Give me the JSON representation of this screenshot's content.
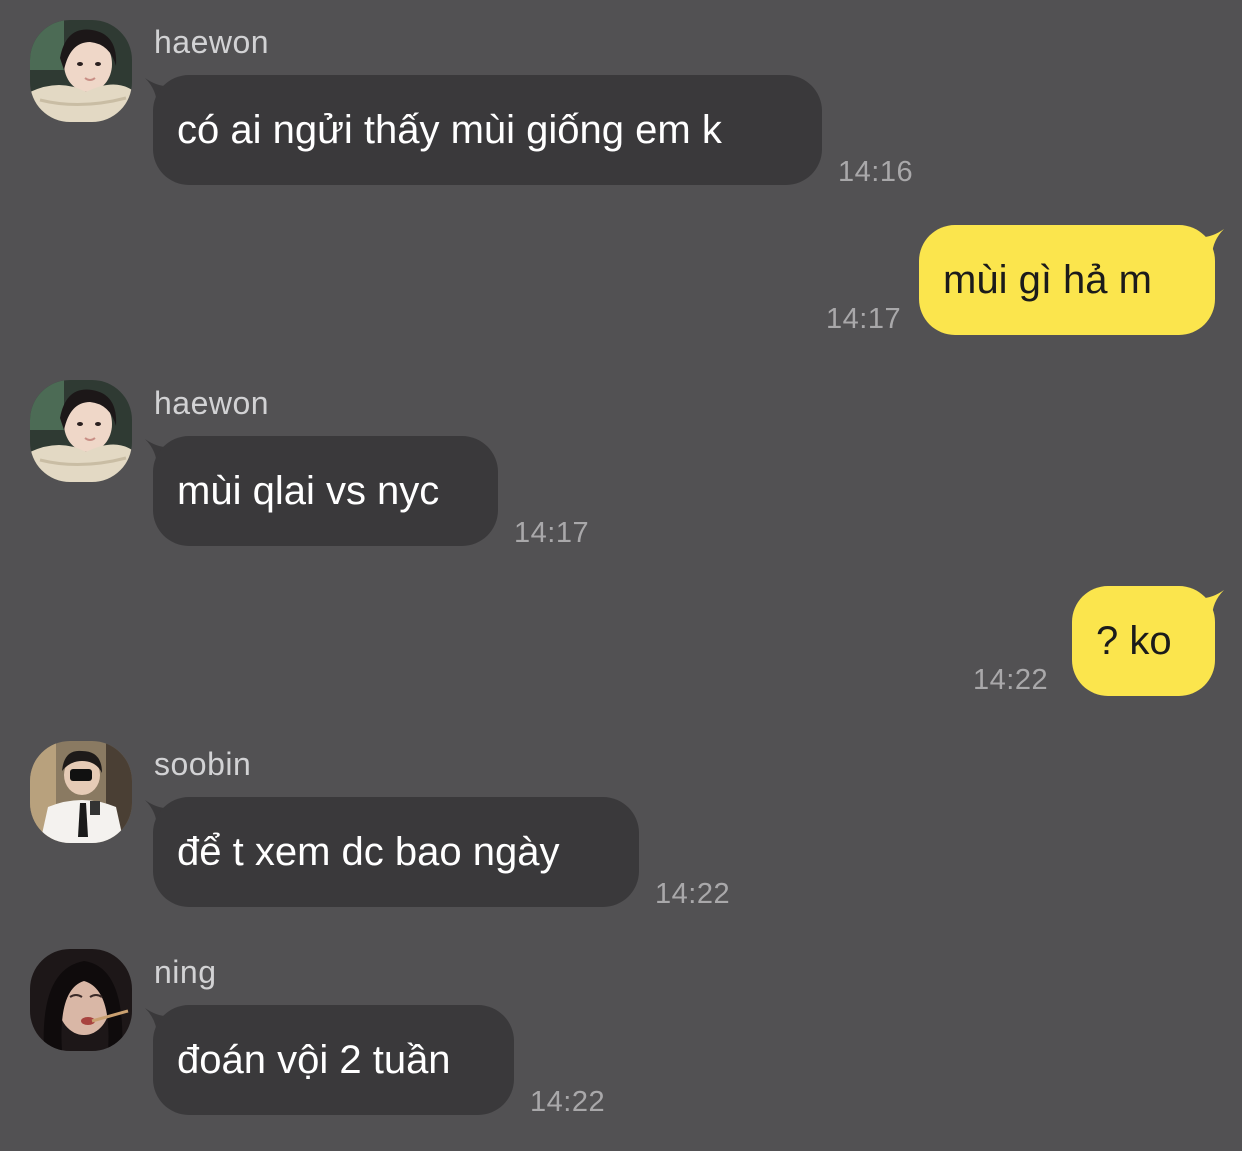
{
  "messages": [
    {
      "sender": "haewon",
      "text": "có ai ngửi thấy mùi giống em k",
      "time": "14:16",
      "avatar": "avatar-haewon"
    },
    {
      "text": "mùi gì hả m",
      "time": "14:17"
    },
    {
      "sender": "haewon",
      "text": "mùi qlai vs nyc",
      "time": "14:17",
      "avatar": "avatar-haewon"
    },
    {
      "text": "? ko",
      "time": "14:22"
    },
    {
      "sender": "soobin",
      "text": "để t xem dc bao ngày",
      "time": "14:22",
      "avatar": "avatar-soobin"
    },
    {
      "sender": "ning",
      "text": "đoán vội 2 tuần",
      "time": "14:22",
      "avatar": "avatar-ning"
    }
  ],
  "colors": {
    "background": "#525153",
    "incoming_bubble": "#3a393b",
    "outgoing_bubble": "#fbe54d",
    "time_text": "#a9a8aa",
    "sender_text": "#d2d2d4"
  }
}
